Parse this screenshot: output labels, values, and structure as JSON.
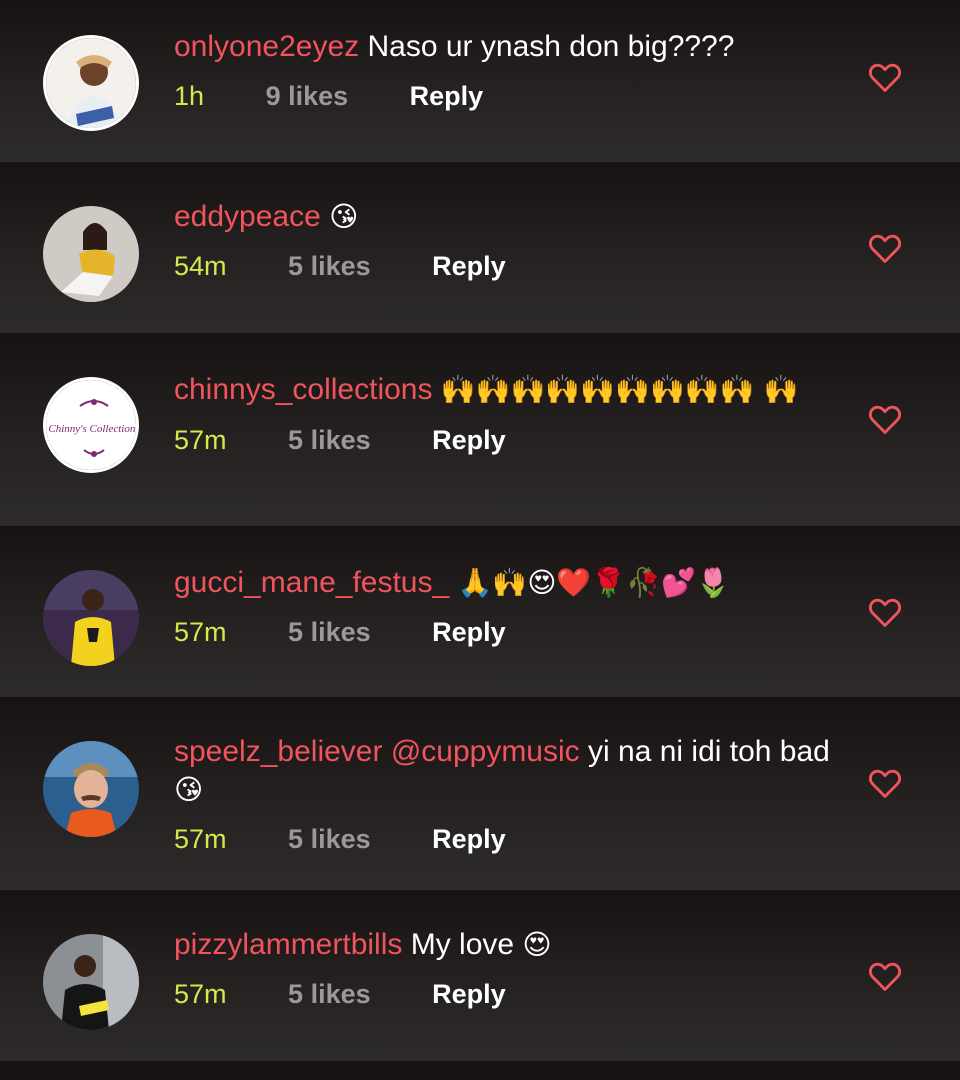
{
  "accent_color": "#f0545d",
  "time_color": "#d8e84a",
  "comments": [
    {
      "username": "onlyone2eyez",
      "text": "Naso ur ynash don big????",
      "emoji": "",
      "mention": "",
      "time": "1h",
      "likes": "9 likes",
      "reply": "Reply",
      "avatar_icon": "user-avatar-icon",
      "like_icon": "heart-outline-icon"
    },
    {
      "username": "eddypeace",
      "text": "",
      "emoji": "😘",
      "mention": "",
      "time": "54m",
      "likes": "5 likes",
      "reply": "Reply",
      "avatar_icon": "user-avatar-icon",
      "like_icon": "heart-outline-icon"
    },
    {
      "username": "chinnys_collections",
      "text": "",
      "emoji": "🙌🙌🙌🙌🙌🙌🙌🙌🙌 🙌",
      "mention": "",
      "time": "57m",
      "likes": "5 likes",
      "reply": "Reply",
      "avatar_icon": "brand-logo-avatar-icon",
      "avatar_text": "Chinny's Collections",
      "like_icon": "heart-outline-icon"
    },
    {
      "username": "gucci_mane_festus_",
      "text": "",
      "emoji": "🙏🙌😍❤️🌹🥀💕🌷",
      "mention": "",
      "time": "57m",
      "likes": "5 likes",
      "reply": "Reply",
      "avatar_icon": "user-avatar-icon",
      "like_icon": "heart-outline-icon"
    },
    {
      "username": "speelz_believer",
      "text": "yi na ni idi toh bad",
      "emoji": "😘",
      "mention": "@cuppymusic",
      "time": "57m",
      "likes": "5 likes",
      "reply": "Reply",
      "avatar_icon": "user-avatar-icon",
      "like_icon": "heart-outline-icon"
    },
    {
      "username": "pizzylammertbills",
      "text": "My love",
      "emoji": "😍",
      "mention": "",
      "time": "57m",
      "likes": "5 likes",
      "reply": "Reply",
      "avatar_icon": "user-avatar-icon",
      "like_icon": "heart-outline-icon"
    }
  ]
}
